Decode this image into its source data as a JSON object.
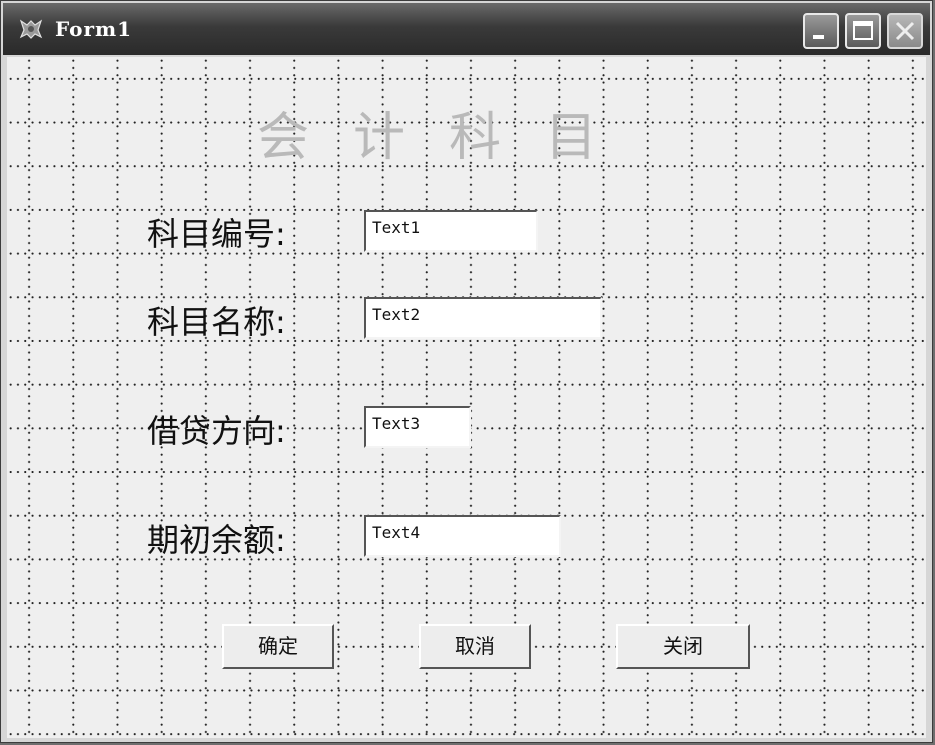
{
  "window": {
    "title": "Form1"
  },
  "form": {
    "heading": "会计科目",
    "fields": [
      {
        "label": "科目编号:",
        "value": "Text1"
      },
      {
        "label": "科目名称:",
        "value": "Text2"
      },
      {
        "label": "借贷方向:",
        "value": "Text3"
      },
      {
        "label": "期初余额:",
        "value": "Text4"
      }
    ]
  },
  "buttons": {
    "ok": "确定",
    "cancel": "取消",
    "close": "关闭"
  },
  "icons": [
    "app-icon",
    "minimize-icon",
    "maximize-icon",
    "close-icon"
  ]
}
